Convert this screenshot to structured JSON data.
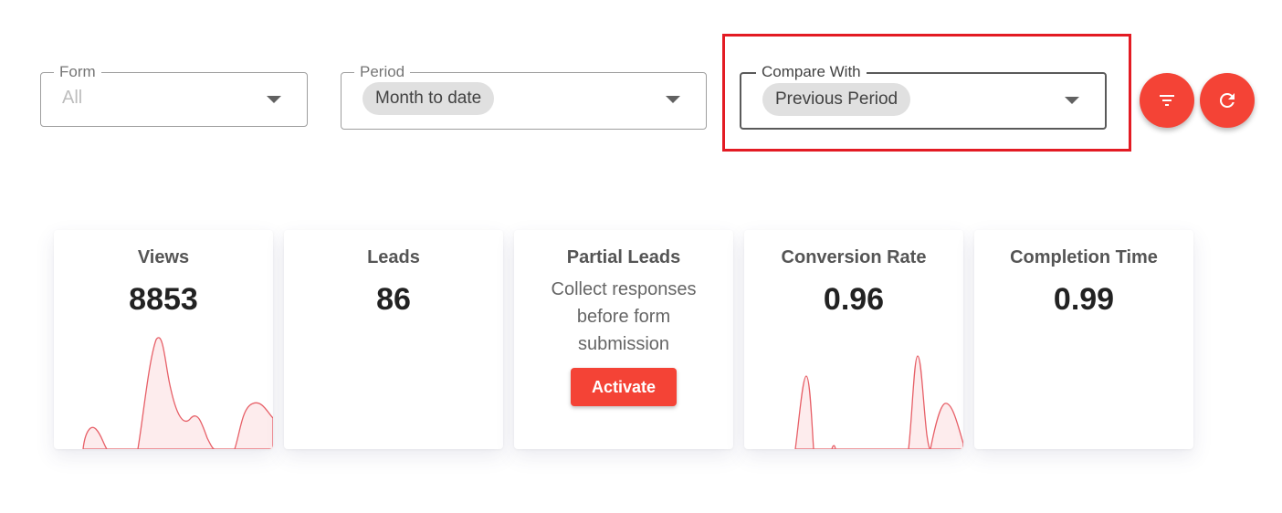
{
  "filters": {
    "form": {
      "legend": "Form",
      "value": "All"
    },
    "period": {
      "legend": "Period",
      "value": "Month to date"
    },
    "compare": {
      "legend": "Compare With",
      "value": "Previous Period"
    }
  },
  "actions": {
    "filter_icon": "filter-list-icon",
    "refresh_icon": "refresh-icon"
  },
  "colors": {
    "accent": "#f44336",
    "highlight": "#e31b23"
  },
  "stats": {
    "views": {
      "title": "Views",
      "value": "8853"
    },
    "leads": {
      "title": "Leads",
      "value": "86"
    },
    "partial": {
      "title": "Partial Leads",
      "description": "Collect responses before form submission",
      "button": "Activate"
    },
    "conversion": {
      "title": "Conversion Rate",
      "value": "0.96"
    },
    "completion": {
      "title": "Completion Time",
      "value": "0.99"
    }
  }
}
